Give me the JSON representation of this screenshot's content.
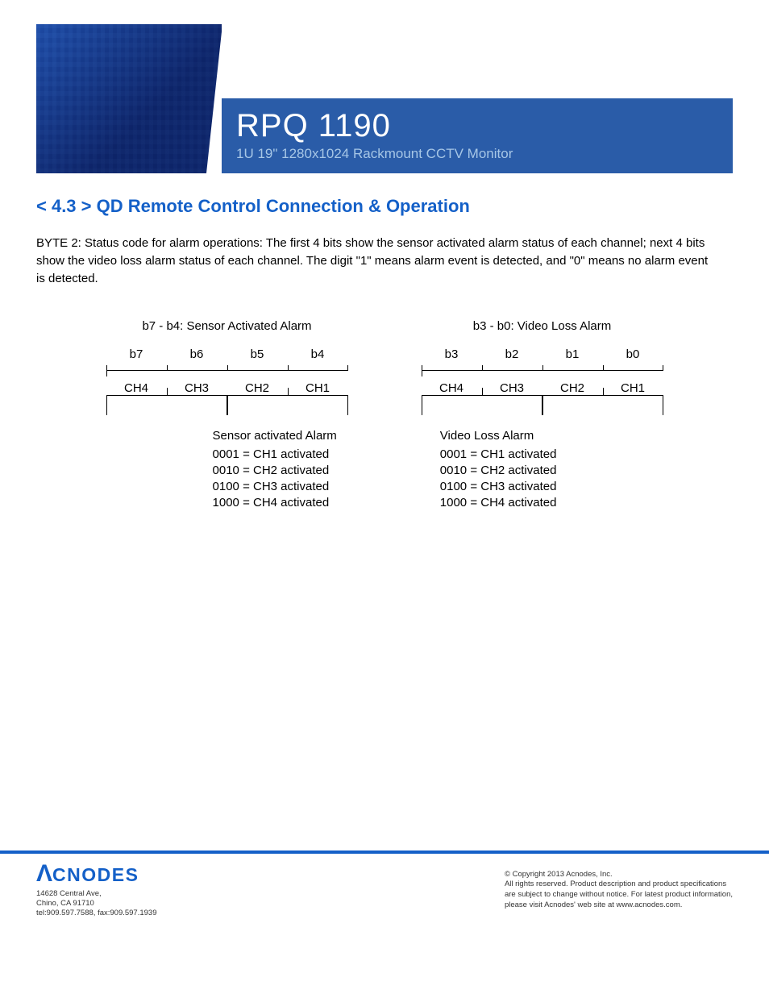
{
  "header": {
    "product_name": "RPQ 1190",
    "product_desc": "1U 19\" 1280x1024 Rackmount CCTV Monitor"
  },
  "section": {
    "title": "< 4.3 > QD  Remote Control Connection & Operation",
    "body_text": "BYTE 2: Status code for alarm operations: The first 4 bits show the sensor activated alarm status of each channel; next 4 bits show the video loss alarm status of each channel. The digit  \"1\" means alarm event is detected, and \"0\" means no alarm event is detected."
  },
  "diagram": {
    "left": {
      "heading": "b7 - b4: Sensor Activated Alarm",
      "bits": [
        "b7",
        "b6",
        "b5",
        "b4"
      ],
      "channels": [
        "CH4",
        "CH3",
        "CH2",
        "CH1"
      ]
    },
    "right": {
      "heading": "b3 - b0: Video Loss Alarm",
      "bits": [
        "b3",
        "b2",
        "b1",
        "b0"
      ],
      "channels": [
        "CH4",
        "CH3",
        "CH2",
        "CH1"
      ]
    }
  },
  "alarms": {
    "sensor": {
      "title": "Sensor activated Alarm",
      "lines": [
        "0001 = CH1 activated",
        "0010 = CH2 activated",
        "0100 = CH3 activated",
        "1000 = CH4 activated"
      ]
    },
    "video": {
      "title": "Video Loss Alarm",
      "lines": [
        "0001 = CH1 activated",
        "0010 = CH2 activated",
        "0100 = CH3 activated",
        "1000 = CH4 activated"
      ]
    }
  },
  "footer": {
    "logo_a": "Λ",
    "logo_text": "CNODES",
    "address_l1": "14628 Central Ave,",
    "address_l2": "Chino, CA 91710",
    "address_l3": "tel:909.597.7588, fax:909.597.1939",
    "copy_l1": "© Copyright 2013 Acnodes, Inc.",
    "copy_l2": "All rights reserved. Product description and product specifications",
    "copy_l3": "are subject to change without notice. For latest product information,",
    "copy_l4": "please visit Acnodes' web site at www.acnodes.com."
  }
}
